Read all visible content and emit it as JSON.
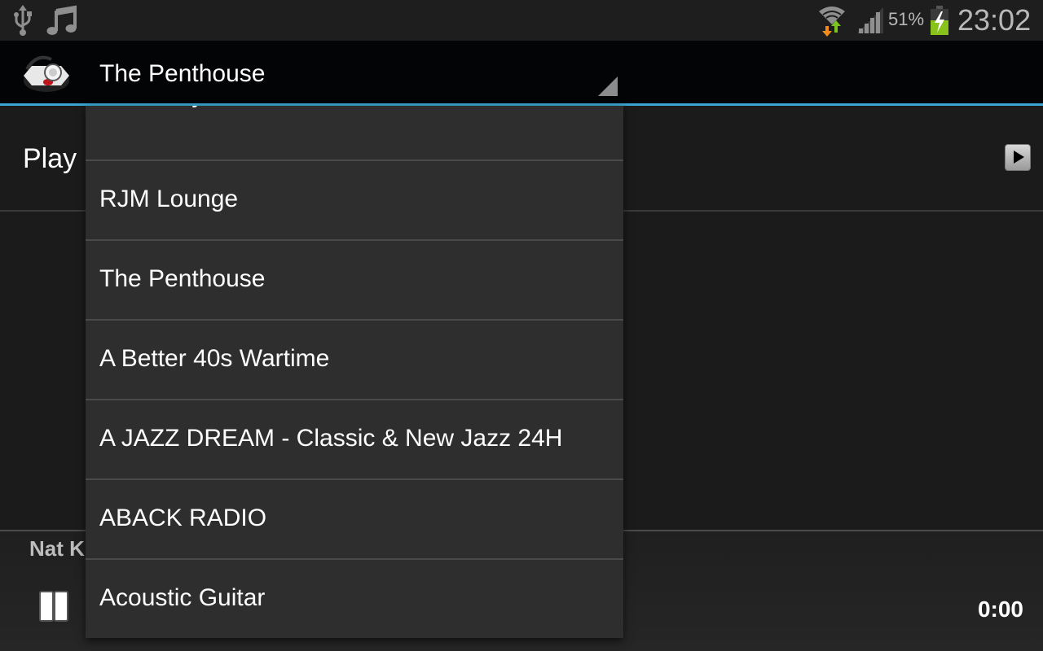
{
  "status_bar": {
    "left_icons": [
      "usb-icon",
      "music-note-icon"
    ],
    "right_icons": [
      "wifi-icon",
      "signal-icon",
      "battery-charging-icon"
    ],
    "battery_percent": "51%",
    "time": "23:02",
    "colors": {
      "battery_fill": "#8ac21c",
      "wifi_down": "#f08c1e",
      "wifi_up": "#7cc41e"
    }
  },
  "action_bar": {
    "app_icon": "radio-headphones-icon",
    "selected_station": "The Penthouse",
    "accent_color": "#3aa6d1"
  },
  "main": {
    "play_label": "Play",
    "play_button_icon": "play-icon"
  },
  "player": {
    "track_title": "Nat K",
    "pause_icon": "pause-icon",
    "elapsed": "0:00"
  },
  "dropdown": {
    "items": [
      {
        "label": "RadioSky Music"
      },
      {
        "label": "RJM Lounge"
      },
      {
        "label": "The Penthouse"
      },
      {
        "label": "A Better 40s Wartime"
      },
      {
        "label": "A JAZZ DREAM - Classic & New Jazz 24H"
      },
      {
        "label": "ABACK RADIO"
      },
      {
        "label": "Acoustic Guitar"
      }
    ]
  }
}
